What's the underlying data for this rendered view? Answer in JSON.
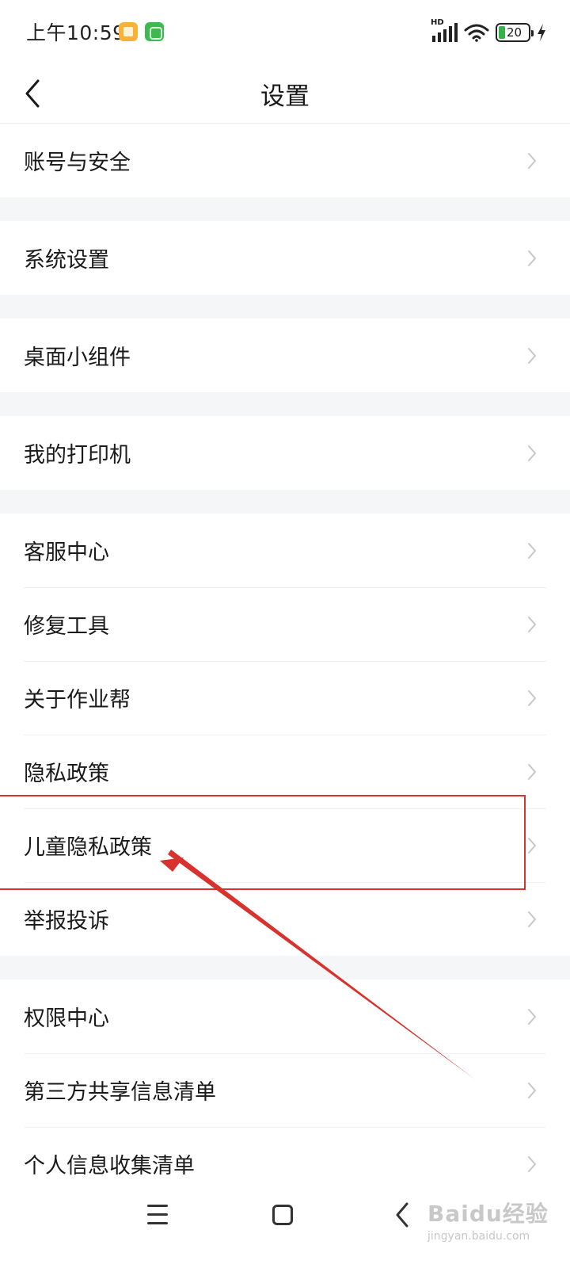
{
  "status_bar": {
    "time": "上午10:59",
    "hd_label": "HD",
    "battery_level": "20"
  },
  "header": {
    "title": "设置"
  },
  "groups": [
    {
      "items": [
        {
          "label": "账号与安全"
        }
      ]
    },
    {
      "items": [
        {
          "label": "系统设置"
        }
      ]
    },
    {
      "items": [
        {
          "label": "桌面小组件"
        }
      ]
    },
    {
      "items": [
        {
          "label": "我的打印机"
        }
      ]
    },
    {
      "items": [
        {
          "label": "客服中心"
        },
        {
          "label": "修复工具"
        },
        {
          "label": "关于作业帮"
        },
        {
          "label": "隐私政策"
        },
        {
          "label": "儿童隐私政策"
        },
        {
          "label": "举报投诉"
        }
      ]
    },
    {
      "items": [
        {
          "label": "权限中心"
        },
        {
          "label": "第三方共享信息清单"
        },
        {
          "label": "个人信息收集清单"
        }
      ]
    }
  ],
  "annotation": {
    "highlighted_item": "儿童隐私政策",
    "color": "#d8322f"
  },
  "watermark": {
    "logo": "Baidu经验",
    "url": "jingyan.baidu.com"
  },
  "colors": {
    "background": "#ffffff",
    "group_gap": "#f5f6f8",
    "text": "#1a1a1a",
    "chevron": "#c4c7cc",
    "battery_fill": "#35b34a"
  },
  "icons": [
    "back-arrow-icon",
    "chevron-right-icon",
    "wifi-icon",
    "signal-icon",
    "battery-icon",
    "charging-bolt-icon",
    "menu-icon",
    "home-icon",
    "nav-back-icon"
  ]
}
